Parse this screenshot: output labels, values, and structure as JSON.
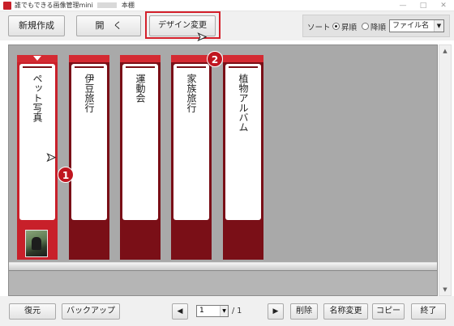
{
  "window": {
    "title_prefix": "誰でもできる画像管理mini",
    "title_suffix": "本棚",
    "minimize": "—",
    "maximize": "□",
    "close": "✕"
  },
  "toolbar": {
    "new_label": "新規作成",
    "open_label": "開　く",
    "design_label": "デザイン変更",
    "sort_label": "ソート",
    "sort_asc_label": "昇順",
    "sort_desc_label": "降順",
    "sort_selected": "昇順",
    "sort_field": "ファイル名"
  },
  "albums": [
    {
      "title": "ペット写真",
      "selected": true,
      "has_thumbnail": true
    },
    {
      "title": "伊豆旅行",
      "selected": false,
      "has_thumbnail": false
    },
    {
      "title": "運動会",
      "selected": false,
      "has_thumbnail": false
    },
    {
      "title": "家族旅行",
      "selected": false,
      "has_thumbnail": false
    },
    {
      "title": "植物アルバム",
      "selected": false,
      "has_thumbnail": false
    }
  ],
  "callouts": {
    "one": "1",
    "two": "2"
  },
  "bottombar": {
    "restore_label": "復元",
    "backup_label": "バックアップ",
    "prev_label": "◀",
    "next_label": "▶",
    "page_current": "1",
    "page_total": "/ 1",
    "delete_label": "削除",
    "rename_label": "名称変更",
    "copy_label": "コピー",
    "exit_label": "終了"
  },
  "colors": {
    "album_selected": "#c8202a",
    "album_default": "#7a0f17",
    "highlight": "#d4202b",
    "callout": "#c0151f"
  },
  "icons": {
    "app": "app-icon",
    "cursor": "mouse-pointer-icon",
    "scroll_up": "triangle-up-icon",
    "scroll_down": "triangle-down-icon"
  }
}
